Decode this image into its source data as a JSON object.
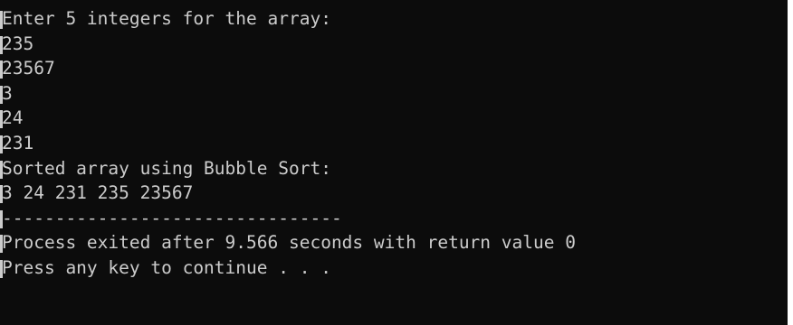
{
  "console": {
    "lines": [
      "Enter 5 integers for the array:",
      "235",
      "23567",
      "3",
      "24",
      "231",
      "Sorted array using Bubble Sort:",
      "3 24 231 235 23567",
      "--------------------------------",
      "Process exited after 9.566 seconds with return value 0",
      "Press any key to continue . . ."
    ],
    "colors": {
      "background": "#0c0c0c",
      "text": "#cccccc"
    }
  }
}
